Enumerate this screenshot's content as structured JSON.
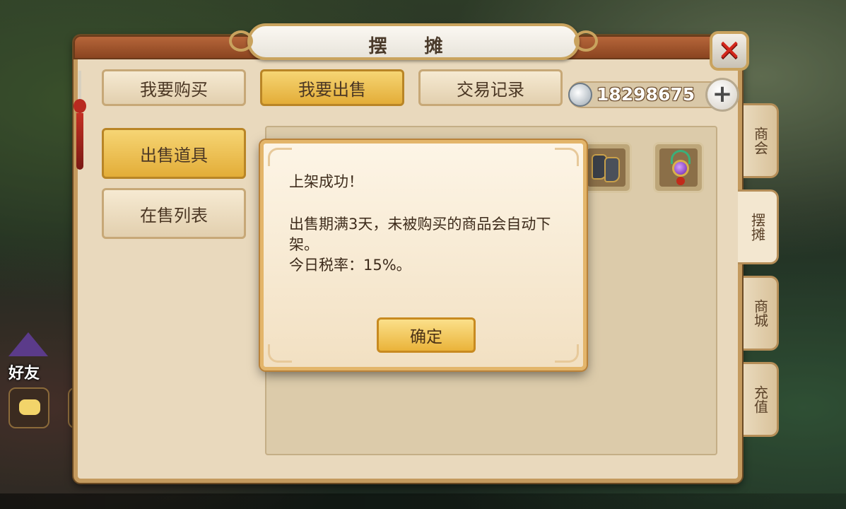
{
  "panel": {
    "title": "摆 摊",
    "close_icon": "close-x-icon"
  },
  "top_tabs": [
    {
      "label": "我要购买",
      "active": false
    },
    {
      "label": "我要出售",
      "active": true
    },
    {
      "label": "交易记录",
      "active": false
    }
  ],
  "currency": {
    "amount": "18298675",
    "icon": "silver-coin-icon",
    "add_icon": "plus-icon"
  },
  "left_menu": [
    {
      "label": "出售道具",
      "active": true
    },
    {
      "label": "在售列表",
      "active": false
    }
  ],
  "items": [
    {
      "name": "boots-item-icon"
    },
    {
      "name": "amulet-item-icon"
    }
  ],
  "side_tabs": [
    {
      "label": "商会",
      "active": false
    },
    {
      "label": "摆摊",
      "active": true
    },
    {
      "label": "商城",
      "active": false
    },
    {
      "label": "充值",
      "active": false
    }
  ],
  "dialog": {
    "title": "上架成功！",
    "line1": "出售期满3天，未被购买的商品会自动下架。",
    "line2": "今日税率：15%。",
    "confirm_label": "确定"
  },
  "hud": {
    "friends_label": "好友",
    "chat_icon": "chat-bubble-icon"
  },
  "colors": {
    "active_tab": "#e3ad38",
    "panel_bg": "#e9d9bd",
    "close_x": "#d3271b"
  }
}
